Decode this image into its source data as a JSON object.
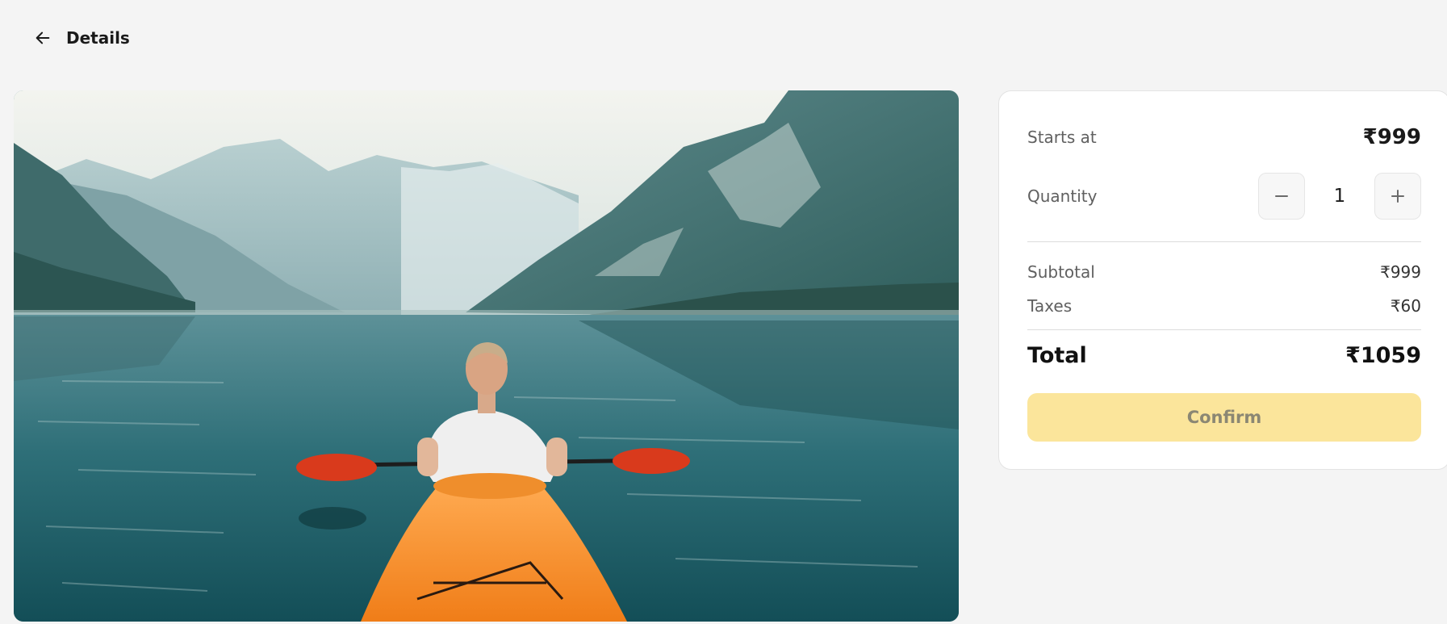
{
  "header": {
    "back_icon": "arrow-left-icon",
    "title": "Details"
  },
  "hero": {
    "description_icon": "kayak-lake-photo"
  },
  "booking": {
    "starts_at_label": "Starts at",
    "starts_at_price": "₹999",
    "quantity_label": "Quantity",
    "quantity_value": "1",
    "decrement_icon": "minus-icon",
    "increment_icon": "plus-icon",
    "subtotal_label": "Subtotal",
    "subtotal_value": "₹999",
    "taxes_label": "Taxes",
    "taxes_value": "₹60",
    "total_label": "Total",
    "total_value": "₹1059",
    "confirm_label": "Confirm"
  },
  "colors": {
    "page_bg": "#f4f4f4",
    "card_bg": "#ffffff",
    "confirm_bg": "#fbe59b",
    "confirm_text": "#8b8773"
  }
}
